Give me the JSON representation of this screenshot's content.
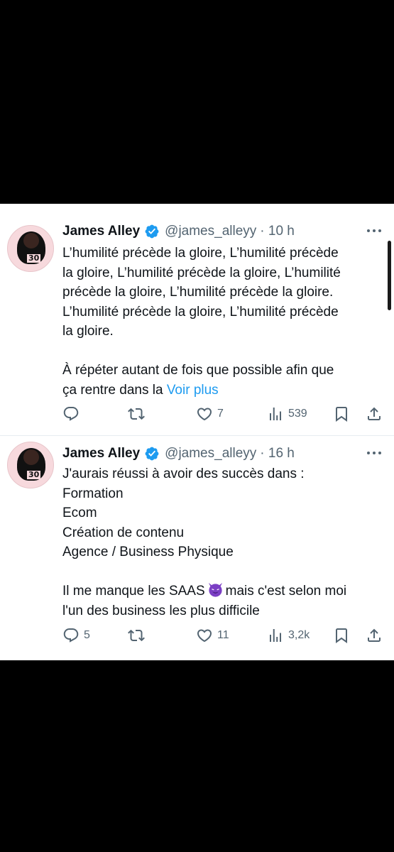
{
  "tweets": [
    {
      "author": "James Alley",
      "handle": "@james_alleyy",
      "time": "· 10 h",
      "avatar_badge": "30",
      "text_lines": [
        "L’humilité précède la gloire, L’humilité précède",
        "la gloire, L’humilité précède la gloire, L’humilité",
        "précède la gloire, L’humilité précède la gloire.",
        "L’humilité précède la gloire, L’humilité précède",
        "la gloire."
      ],
      "text_after_blank": "À répéter autant de fois que possible afin que",
      "text_last": "ça rentre dans la ",
      "see_more": "Voir plus",
      "replies": "",
      "retweets": "",
      "likes": "7",
      "views": "539"
    },
    {
      "author": "James Alley",
      "handle": "@james_alleyy",
      "time": "· 16 h",
      "avatar_badge": "30",
      "text_lines": [
        "J'aurais réussi à avoir des succès dans :",
        "Formation",
        "Ecom",
        "Création de contenu",
        "Agence / Business Physique"
      ],
      "text_saas_before": "Il me manque les SAAS",
      "text_saas_after": "mais c'est selon moi",
      "text_last": "l'un des business les plus difficile",
      "replies": "5",
      "retweets": "",
      "likes": "11",
      "views": "3,2k"
    }
  ],
  "icons": {
    "verified": "verified-badge-icon",
    "more": "more-dots-icon",
    "reply": "reply-icon",
    "retweet": "retweet-icon",
    "like": "heart-icon",
    "views": "views-chart-icon",
    "bookmark": "bookmark-icon",
    "share": "share-icon",
    "emoji": "smiling-devil-emoji"
  },
  "colors": {
    "background": "#000000",
    "card": "#ffffff",
    "text": "#0f1419",
    "secondary": "#536471",
    "link": "#1d9bf0",
    "verified": "#1d9bf0",
    "emoji": "#7b3fc4"
  }
}
